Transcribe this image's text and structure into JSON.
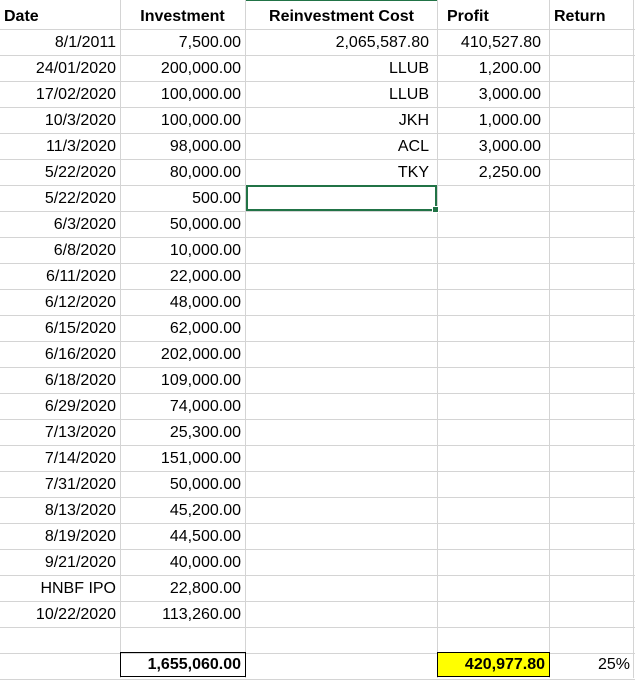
{
  "headers": {
    "date": "Date",
    "investment": "Investment",
    "reinvestment_cost": "Reinvestment Cost",
    "profit": "Profit",
    "return": "Return"
  },
  "rows": [
    {
      "date": "8/1/2011",
      "investment": "7,500.00",
      "reinvestment_cost": "2,065,587.80",
      "profit": "410,527.80"
    },
    {
      "date": "24/01/2020",
      "investment": "200,000.00",
      "reinvestment_cost": "LLUB",
      "profit": "1,200.00"
    },
    {
      "date": "17/02/2020",
      "investment": "100,000.00",
      "reinvestment_cost": "LLUB",
      "profit": "3,000.00"
    },
    {
      "date": "10/3/2020",
      "investment": "100,000.00",
      "reinvestment_cost": "JKH",
      "profit": "1,000.00"
    },
    {
      "date": "11/3/2020",
      "investment": "98,000.00",
      "reinvestment_cost": "ACL",
      "profit": "3,000.00"
    },
    {
      "date": "5/22/2020",
      "investment": "80,000.00",
      "reinvestment_cost": "TKY",
      "profit": "2,250.00"
    },
    {
      "date": "5/22/2020",
      "investment": "500.00",
      "reinvestment_cost": "",
      "profit": ""
    },
    {
      "date": "6/3/2020",
      "investment": "50,000.00",
      "reinvestment_cost": "",
      "profit": ""
    },
    {
      "date": "6/8/2020",
      "investment": "10,000.00",
      "reinvestment_cost": "",
      "profit": ""
    },
    {
      "date": "6/11/2020",
      "investment": "22,000.00",
      "reinvestment_cost": "",
      "profit": ""
    },
    {
      "date": "6/12/2020",
      "investment": "48,000.00",
      "reinvestment_cost": "",
      "profit": ""
    },
    {
      "date": "6/15/2020",
      "investment": "62,000.00",
      "reinvestment_cost": "",
      "profit": ""
    },
    {
      "date": "6/16/2020",
      "investment": "202,000.00",
      "reinvestment_cost": "",
      "profit": ""
    },
    {
      "date": "6/18/2020",
      "investment": "109,000.00",
      "reinvestment_cost": "",
      "profit": ""
    },
    {
      "date": "6/29/2020",
      "investment": "74,000.00",
      "reinvestment_cost": "",
      "profit": ""
    },
    {
      "date": "7/13/2020",
      "investment": "25,300.00",
      "reinvestment_cost": "",
      "profit": ""
    },
    {
      "date": "7/14/2020",
      "investment": "151,000.00",
      "reinvestment_cost": "",
      "profit": ""
    },
    {
      "date": "7/31/2020",
      "investment": "50,000.00",
      "reinvestment_cost": "",
      "profit": ""
    },
    {
      "date": "8/13/2020",
      "investment": "45,200.00",
      "reinvestment_cost": "",
      "profit": ""
    },
    {
      "date": "8/19/2020",
      "investment": "44,500.00",
      "reinvestment_cost": "",
      "profit": ""
    },
    {
      "date": "9/21/2020",
      "investment": "40,000.00",
      "reinvestment_cost": "",
      "profit": ""
    },
    {
      "date": "HNBF IPO",
      "investment": "22,800.00",
      "reinvestment_cost": "",
      "profit": ""
    },
    {
      "date": "10/22/2020",
      "investment": "113,260.00",
      "reinvestment_cost": "",
      "profit": ""
    }
  ],
  "totals": {
    "investment": "1,655,060.00",
    "profit": "420,977.80",
    "return": "25%"
  },
  "colors": {
    "gridline": "#d4d4d4",
    "selection": "#217346",
    "highlight": "#ffff00"
  }
}
